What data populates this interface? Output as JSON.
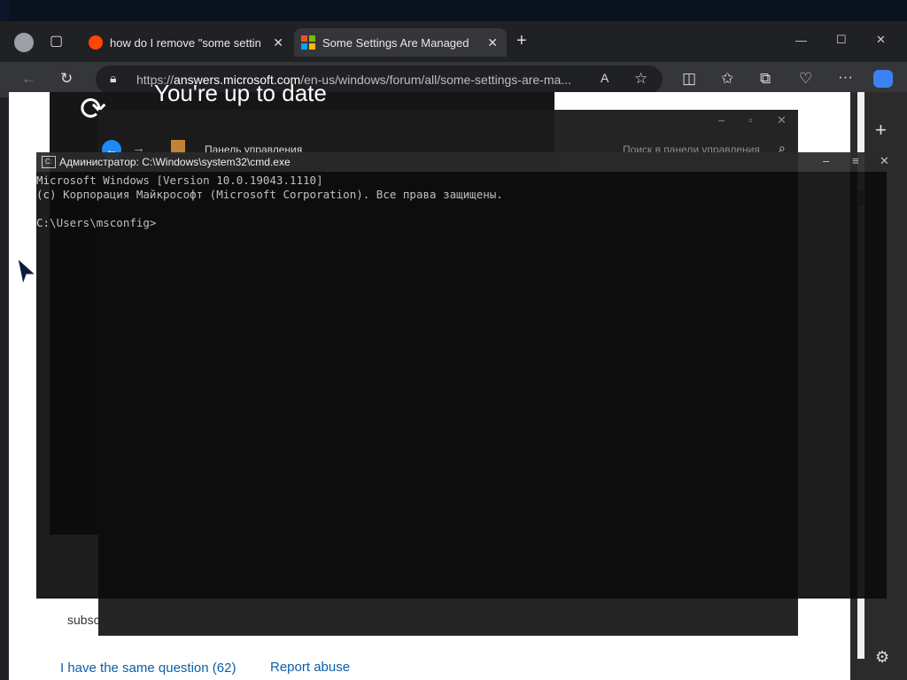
{
  "browser": {
    "tabs": [
      {
        "title": "how do I remove \"some settings",
        "close": "✕"
      },
      {
        "title": "Some Settings Are Managed By Y",
        "close": "✕"
      }
    ],
    "new_tab": "+",
    "url_prefix": "https://",
    "url_domain": "answers.microsoft.com",
    "url_path": "/en-us/windows/forum/all/some-settings-are-ma...",
    "window_controls": {
      "minimize": "—",
      "maximize": "☐",
      "close": "✕"
    }
  },
  "page": {
    "banner_text": "You're up to date",
    "same_question": "I have the same question (62)",
    "report_abuse": "Report abuse",
    "subscribe_fragment": "subsc"
  },
  "control_panel": {
    "title": "Панель управления",
    "search_placeholder": "Поиск в панели управления"
  },
  "cmd": {
    "title": "Администратор: C:\\Windows\\system32\\cmd.exe",
    "lines": [
      "Microsoft Windows [Version 10.0.19043.1110]",
      "(c) Корпорация Майкрософт (Microsoft Corporation). Все права защищены.",
      "",
      "C:\\Users\\msconfig>"
    ]
  },
  "colors": {
    "accent": "#1e90ff",
    "link": "#0a5ea8",
    "cmd_text": "#cccccc"
  }
}
